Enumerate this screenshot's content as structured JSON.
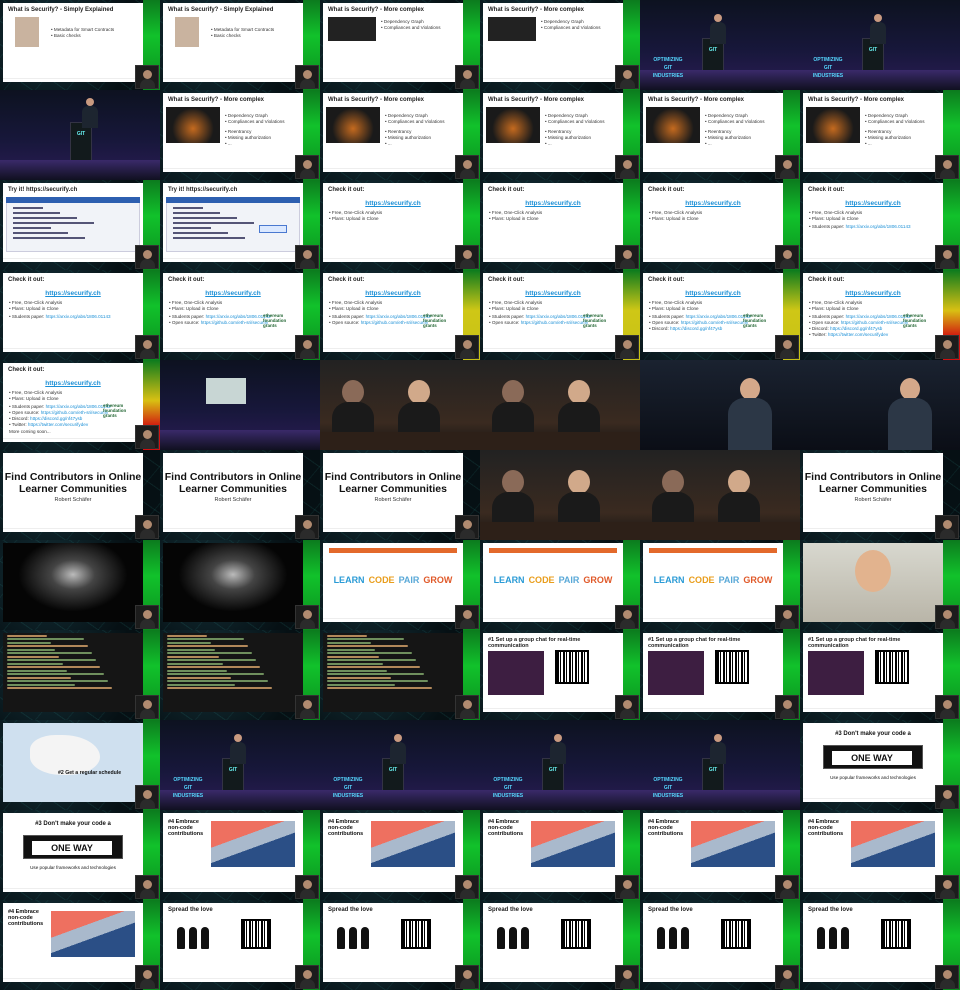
{
  "conference": {
    "brand_lines": [
      "OPTIMIZING",
      "GIT",
      "INDUSTRIES"
    ]
  },
  "text": {
    "slide_simple": "What is Securify? - Simply Explained",
    "b_metadata": "Metadata for Smart Contracts",
    "b_basic": "Basic checks",
    "slide_complex": "What is Securify? - More complex",
    "b_dep": "Dependency Graph",
    "b_comp": "Compliances and Violations",
    "b_reent": "Reentrancy",
    "b_auth": "Missing authorization",
    "b_dots": "...",
    "try_it": "Try it!  https://securify.ch",
    "check_it": "Check it out:",
    "url": "https://securify.ch",
    "b_free": "Free, One-Click Analysis",
    "b_plans": "Plans: Upload in Clone",
    "b_student": "Students paper:",
    "b_open": "Open source:",
    "b_discord": "Discord:",
    "b_twitter": "Twitter:",
    "link_arxiv": "https://arxiv.org/abs/1806.01143",
    "link_github": "https://github.com/eth-sri/securify",
    "link_discord": "https://discord.gg/nf47ysb",
    "link_twitter": "https://twitter.com/securifydev",
    "more_coming": "More coming soon...",
    "ethereum_foundation": "ethereum foundation grants",
    "talk_title": "Find Contributors in Online Learner Communities",
    "talk_author": "Robert Schäfer",
    "learn": "LEARN",
    "code": "CODE",
    "pair": "PAIR",
    "grow": "GROW",
    "tip1": "#1 Set up a group chat for real-time communication",
    "tip2": "#2 Get a regular schedule",
    "tip3": "#3 Don't make your code a",
    "one_way": "ONE WAY",
    "tip3_sub": "Use popular frameworks and technologies",
    "tip4": "#4 Embrace non-code contributions",
    "spread": "Spread the love"
  },
  "colors": {
    "green_panel": "#11c22b",
    "yellow_panel": "#cfc716",
    "red_panel": "#d01010",
    "link": "#1a8fd6",
    "learn": "#2a9bd6",
    "code": "#e99d1b",
    "pair": "#5aa9d8",
    "grow": "#e05a2a"
  },
  "grid": {
    "columns": 6,
    "rows": 11,
    "frames": [
      {
        "k": "simple",
        "p": "green"
      },
      {
        "k": "simple",
        "p": "green"
      },
      {
        "k": "dep",
        "p": "green"
      },
      {
        "k": "dep",
        "p": "green"
      },
      {
        "k": "stage",
        "p": "green"
      },
      {
        "k": "stage",
        "p": "green"
      },
      {
        "k": "stage_close",
        "p": "green"
      },
      {
        "k": "complex",
        "p": "green"
      },
      {
        "k": "complex",
        "p": "green"
      },
      {
        "k": "complex",
        "p": "green"
      },
      {
        "k": "complex",
        "p": "green"
      },
      {
        "k": "complex",
        "p": "green"
      },
      {
        "k": "tryit",
        "p": "green"
      },
      {
        "k": "tryit2",
        "p": "green"
      },
      {
        "k": "check1",
        "p": "green"
      },
      {
        "k": "check1",
        "p": "green"
      },
      {
        "k": "check1",
        "p": "green"
      },
      {
        "k": "check2",
        "p": "green"
      },
      {
        "k": "check2",
        "p": "green"
      },
      {
        "k": "check3",
        "p": "green"
      },
      {
        "k": "check3",
        "p": "yellow"
      },
      {
        "k": "check3",
        "p": "yellow"
      },
      {
        "k": "check4",
        "p": "yellow"
      },
      {
        "k": "check5",
        "p": "red"
      },
      {
        "k": "check6",
        "p": "red"
      },
      {
        "k": "hall",
        "p": "none"
      },
      {
        "k": "panel",
        "p": "none"
      },
      {
        "k": "panel2",
        "p": "none"
      },
      {
        "k": "speaker",
        "p": "none"
      },
      {
        "k": "speaker",
        "p": "none"
      },
      {
        "k": "title",
        "p": "none"
      },
      {
        "k": "title",
        "p": "none"
      },
      {
        "k": "title",
        "p": "none"
      },
      {
        "k": "panel",
        "p": "none"
      },
      {
        "k": "panel",
        "p": "none"
      },
      {
        "k": "title",
        "p": "none"
      },
      {
        "k": "spot",
        "p": "green"
      },
      {
        "k": "spot",
        "p": "green"
      },
      {
        "k": "learn",
        "p": "green"
      },
      {
        "k": "learn",
        "p": "green"
      },
      {
        "k": "learn",
        "p": "green"
      },
      {
        "k": "video",
        "p": "green"
      },
      {
        "k": "code",
        "p": "green"
      },
      {
        "k": "code",
        "p": "green"
      },
      {
        "k": "code",
        "p": "green"
      },
      {
        "k": "tip1",
        "p": "green"
      },
      {
        "k": "tip1",
        "p": "green"
      },
      {
        "k": "tip1",
        "p": "green"
      },
      {
        "k": "map",
        "p": "green"
      },
      {
        "k": "stage",
        "p": "green"
      },
      {
        "k": "stage",
        "p": "green"
      },
      {
        "k": "stage",
        "p": "green"
      },
      {
        "k": "stage",
        "p": "green"
      },
      {
        "k": "oneway",
        "p": "green"
      },
      {
        "k": "oneway",
        "p": "green"
      },
      {
        "k": "chart",
        "p": "green"
      },
      {
        "k": "chart",
        "p": "green"
      },
      {
        "k": "chart",
        "p": "green"
      },
      {
        "k": "chart",
        "p": "green"
      },
      {
        "k": "chart",
        "p": "green"
      },
      {
        "k": "chart",
        "p": "green"
      },
      {
        "k": "spread",
        "p": "green"
      },
      {
        "k": "spread",
        "p": "green"
      },
      {
        "k": "spread",
        "p": "green"
      },
      {
        "k": "spread",
        "p": "green"
      },
      {
        "k": "spread",
        "p": "green"
      }
    ]
  }
}
